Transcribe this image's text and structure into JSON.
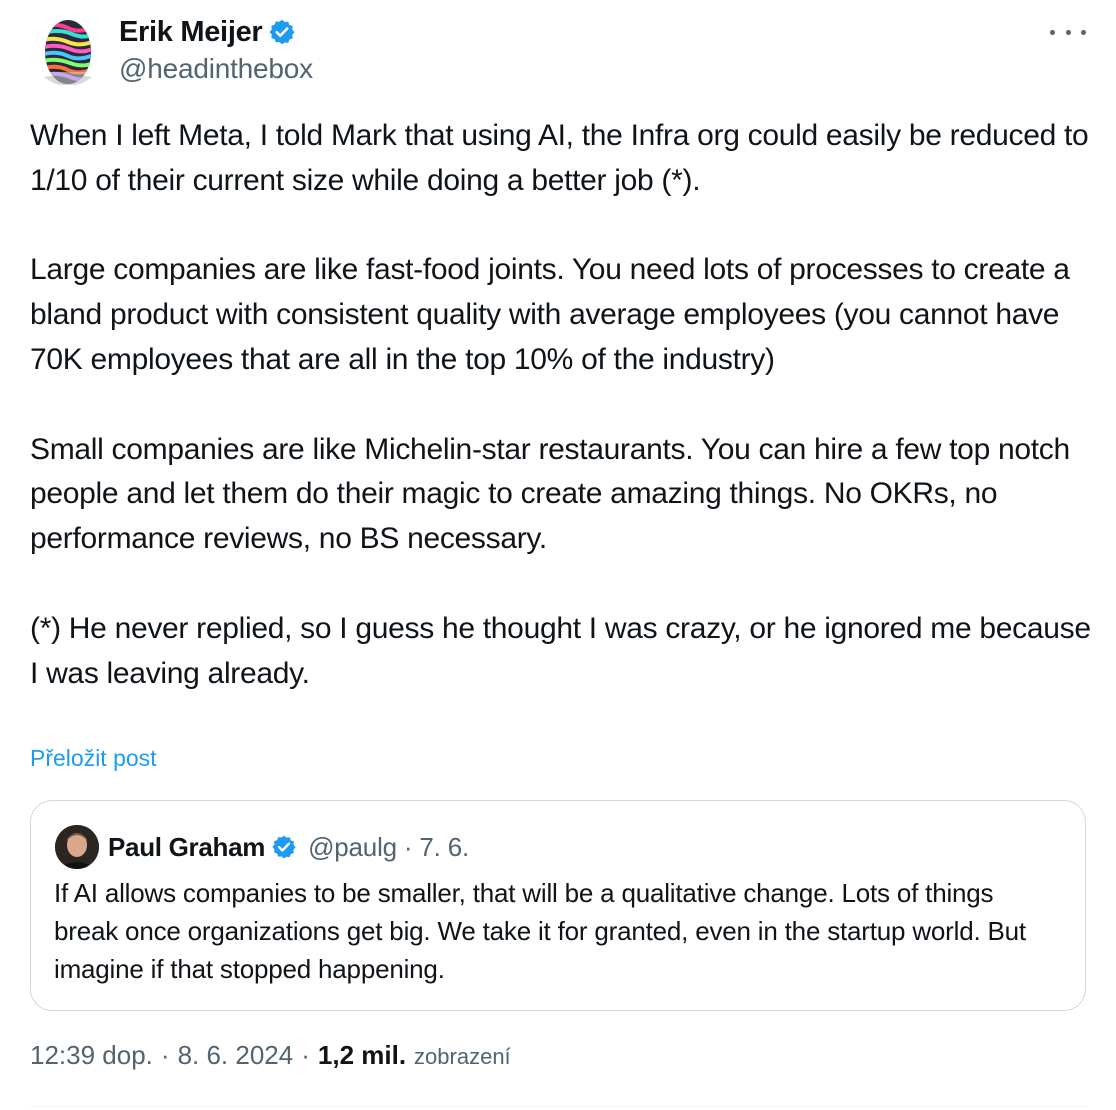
{
  "author": {
    "name": "Erik Meijer",
    "handle": "@headinthebox",
    "verified": true,
    "verified_color": "#1d9bf0"
  },
  "more_icon": "more-horizontal-icon",
  "body": {
    "paragraphs": [
      "When I left Meta, I told Mark that using AI, the Infra org could easily be reduced to 1/10 of their current size while doing a better job (*).",
      "Large companies are like fast-food joints. You need lots of processes to create a bland product with consistent quality with average employees (you cannot have 70K employees that are all in the top 10% of the industry)",
      "Small companies are like Michelin-star restaurants. You can hire a few top notch people and let them do their magic to create amazing things. No OKRs, no performance reviews, no BS necessary.",
      "(*) He never replied, so I guess he thought I was crazy, or he ignored me because I was leaving already."
    ]
  },
  "translate_label": "Přeložit post",
  "quote": {
    "name": "Paul Graham",
    "verified": true,
    "meta": "@paulg · 7. 6.",
    "text": "If AI allows companies to be smaller, that will be a qualitative change. Lots of things break once organizations get big. We take it for granted, even in the startup world. But imagine if that stopped happening."
  },
  "footer": {
    "time": "12:39 dop.",
    "separator": "·",
    "date": "8. 6. 2024",
    "views": "1,2 mil.",
    "views_label": "zobrazení"
  },
  "colors": {
    "text": "#0f1419",
    "secondary": "#536471",
    "link": "#1d9bf0",
    "border": "#cfd9de"
  }
}
